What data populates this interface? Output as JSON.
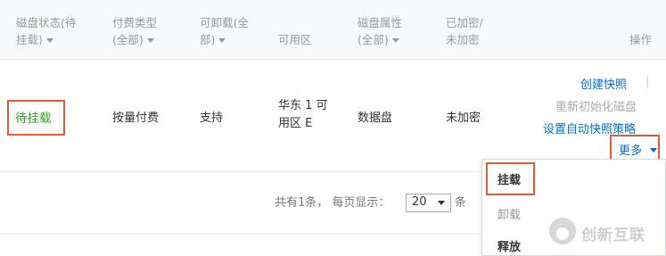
{
  "table": {
    "headers": [
      {
        "line1": "磁盘状态(待",
        "line2": "挂载)"
      },
      {
        "line1": "付费类型",
        "line2": "(全部)"
      },
      {
        "line1": "可卸载(全",
        "line2": "部)"
      },
      {
        "line1": "可用区",
        "line2": ""
      },
      {
        "line1": "磁盘属性",
        "line2": "(全部)"
      },
      {
        "line1": "已加密/",
        "line2": "未加密"
      },
      {
        "line1": "操作",
        "line2": ""
      }
    ],
    "row": {
      "status": "待挂载",
      "billing": "按量付费",
      "detachable": "支持",
      "zone_line1": "华东 1 可",
      "zone_line2": "用区 E",
      "attribute": "数据盘",
      "encryption": "未加密",
      "actions": {
        "create_snapshot": "创建快照",
        "separator": "|",
        "reinit_disk": "重新初始化磁盘",
        "auto_snapshot": "设置自动快照策略",
        "more": "更多"
      }
    }
  },
  "pagination": {
    "summary": "共有1条， 每页显示：",
    "page_size": "20",
    "unit": "条"
  },
  "more_menu": {
    "items": [
      {
        "label": "挂载",
        "state": "highlighted"
      },
      {
        "label": "卸载",
        "state": "disabled"
      },
      {
        "label": "释放",
        "state": "normal"
      }
    ]
  },
  "watermark": {
    "text": "创新互联"
  },
  "colors": {
    "link": "#0070cc",
    "status_green": "#2ea121",
    "annotation_red": "#e05a36",
    "header_bg": "#f7f9fb"
  }
}
